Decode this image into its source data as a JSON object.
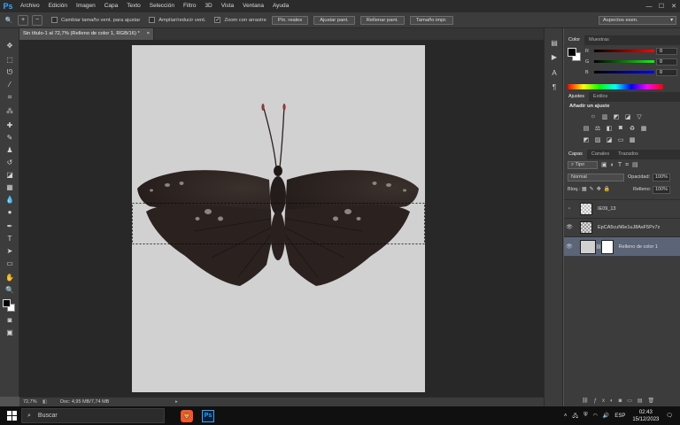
{
  "menubar": {
    "logo": "Ps",
    "items": [
      "Archivo",
      "Edición",
      "Imagen",
      "Capa",
      "Texto",
      "Selección",
      "Filtro",
      "3D",
      "Vista",
      "Ventana",
      "Ayuda"
    ],
    "minimize": "—",
    "maximize": "☐",
    "close": "✕"
  },
  "options": {
    "tool_icon": "🔍",
    "zoom_in": "+",
    "zoom_out": "−",
    "check_resize": "Cambiar tamaño vent. para ajustar",
    "check_zoom_all": "Ampliar/reducir vent.",
    "check_scrubby": "Zoom con arrastre",
    "btn_actual": "Píx. reales",
    "btn_fit": "Ajustar pant.",
    "btn_fill": "Rellenar pant.",
    "btn_print": "Tamaño impr.",
    "workspace": "Aspectos esen."
  },
  "document": {
    "tab_title": "Sin título-1 al 72,7% (Relleno de color 1, RGB/16) *",
    "tab_close": "×"
  },
  "status": {
    "zoom": "72,7%",
    "doc_info": "Doc: 4,95 MB/7,74 MB"
  },
  "color_panel": {
    "tabs": [
      "Color",
      "Muestras"
    ],
    "r_label": "R",
    "g_label": "G",
    "b_label": "B",
    "r": "0",
    "g": "0",
    "b": "0"
  },
  "adjust_panel": {
    "tabs": [
      "Ajustes",
      "Estilos"
    ],
    "title": "Añadir un ajuste"
  },
  "layers_panel": {
    "tabs": [
      "Capas",
      "Canales",
      "Trazados"
    ],
    "filter": "Tipo",
    "blend_mode": "Normal",
    "opacity_label": "Opacidad:",
    "opacity": "100%",
    "lock_label": "Bloq.:",
    "fill_label": "Relleno:",
    "fill": "100%",
    "layers": [
      {
        "name": "IE09_13"
      },
      {
        "name": "EpCA5cuN6e1uJ8AsF5Pv7z..."
      },
      {
        "name": "Relleno de color 1"
      }
    ]
  },
  "taskbar": {
    "search": "Buscar",
    "lang": "ESP",
    "time": "02:43",
    "date": "15/12/2023"
  },
  "colors": {
    "canvas": "#d1d1d1",
    "accent": "#31a8ff"
  }
}
